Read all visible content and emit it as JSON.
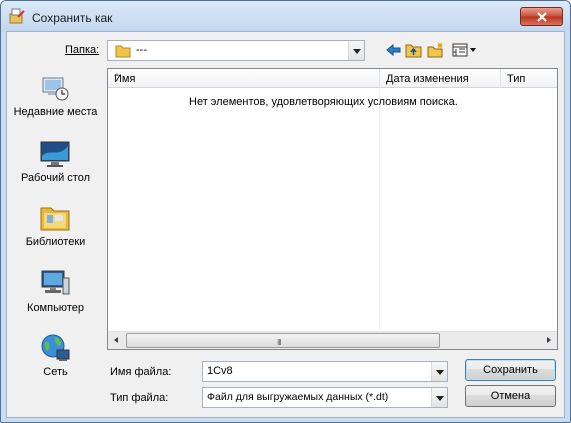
{
  "window": {
    "title": "Сохранить как",
    "title_icon": "save-as-icon",
    "close_icon": "close-icon"
  },
  "toolbar": {
    "folder_label": "Папка:",
    "folder_value": "---",
    "back_icon": "back-arrow-icon",
    "up_icon": "up-folder-icon",
    "new_folder_icon": "new-folder-icon",
    "view_icon": "view-menu-icon"
  },
  "places": [
    {
      "label": "Недавние места",
      "icon": "recent-places-icon"
    },
    {
      "label": "Рабочий стол",
      "icon": "desktop-icon"
    },
    {
      "label": "Библиотеки",
      "icon": "libraries-icon"
    },
    {
      "label": "Компьютер",
      "icon": "computer-icon"
    },
    {
      "label": "Сеть",
      "icon": "network-icon"
    }
  ],
  "filelist": {
    "columns": [
      "Имя",
      "Дата изменения",
      "Тип"
    ],
    "empty_message": "Нет элементов, удовлетворяющих условиям поиска.",
    "scroll_grip": "III"
  },
  "form": {
    "filename_label": "Имя файла:",
    "filename_value": "1Cv8",
    "filetype_label": "Тип файла:",
    "filetype_value": "Файл для выгружаемых данных (*.dt)"
  },
  "buttons": {
    "save": "Сохранить",
    "cancel": "Отмена"
  },
  "colors": {
    "accent": "#3c7fb1",
    "close": "#c94f37",
    "frame": "#c9dcf0"
  }
}
